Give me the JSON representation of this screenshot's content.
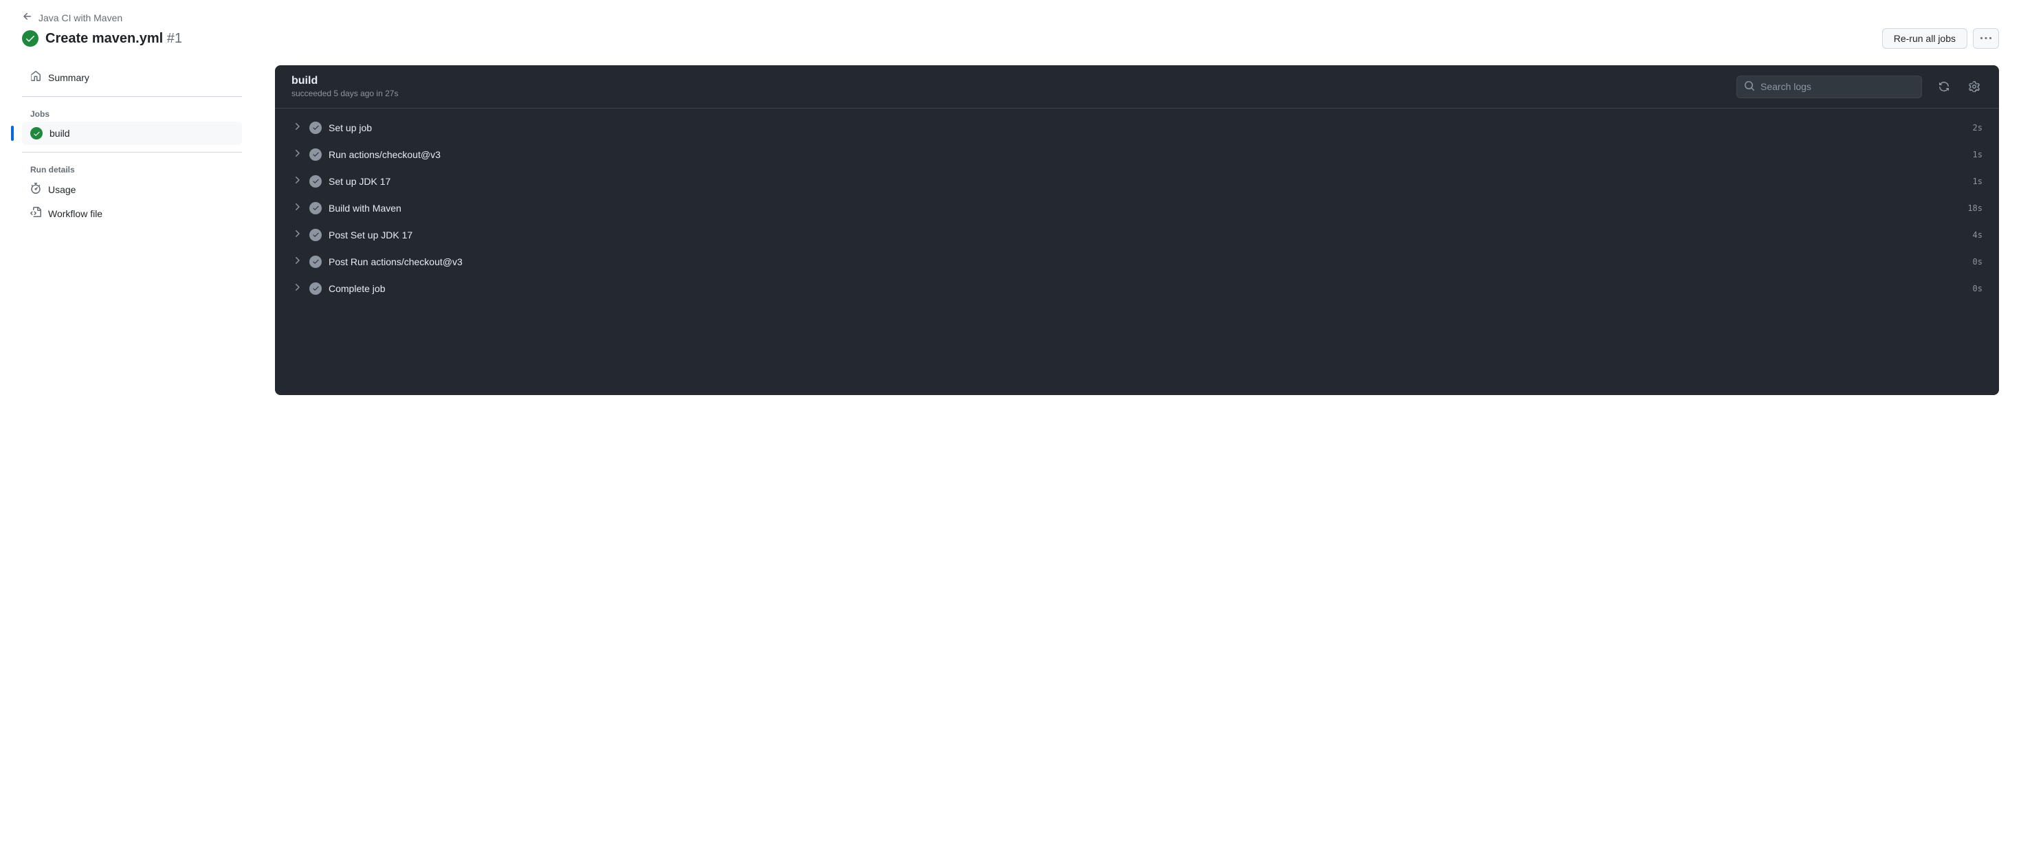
{
  "breadcrumb": {
    "back_label": "Java CI with Maven"
  },
  "header": {
    "title": "Create maven.yml",
    "run_number": "#1",
    "rerun_label": "Re-run all jobs"
  },
  "sidebar": {
    "summary_label": "Summary",
    "jobs_heading": "Jobs",
    "jobs": [
      {
        "name": "build",
        "active": true
      }
    ],
    "run_details_heading": "Run details",
    "usage_label": "Usage",
    "workflow_file_label": "Workflow file"
  },
  "job": {
    "name": "build",
    "meta": "succeeded 5 days ago in 27s",
    "search_placeholder": "Search logs"
  },
  "steps": [
    {
      "name": "Set up job",
      "duration": "2s"
    },
    {
      "name": "Run actions/checkout@v3",
      "duration": "1s"
    },
    {
      "name": "Set up JDK 17",
      "duration": "1s"
    },
    {
      "name": "Build with Maven",
      "duration": "18s"
    },
    {
      "name": "Post Set up JDK 17",
      "duration": "4s"
    },
    {
      "name": "Post Run actions/checkout@v3",
      "duration": "0s"
    },
    {
      "name": "Complete job",
      "duration": "0s"
    }
  ]
}
